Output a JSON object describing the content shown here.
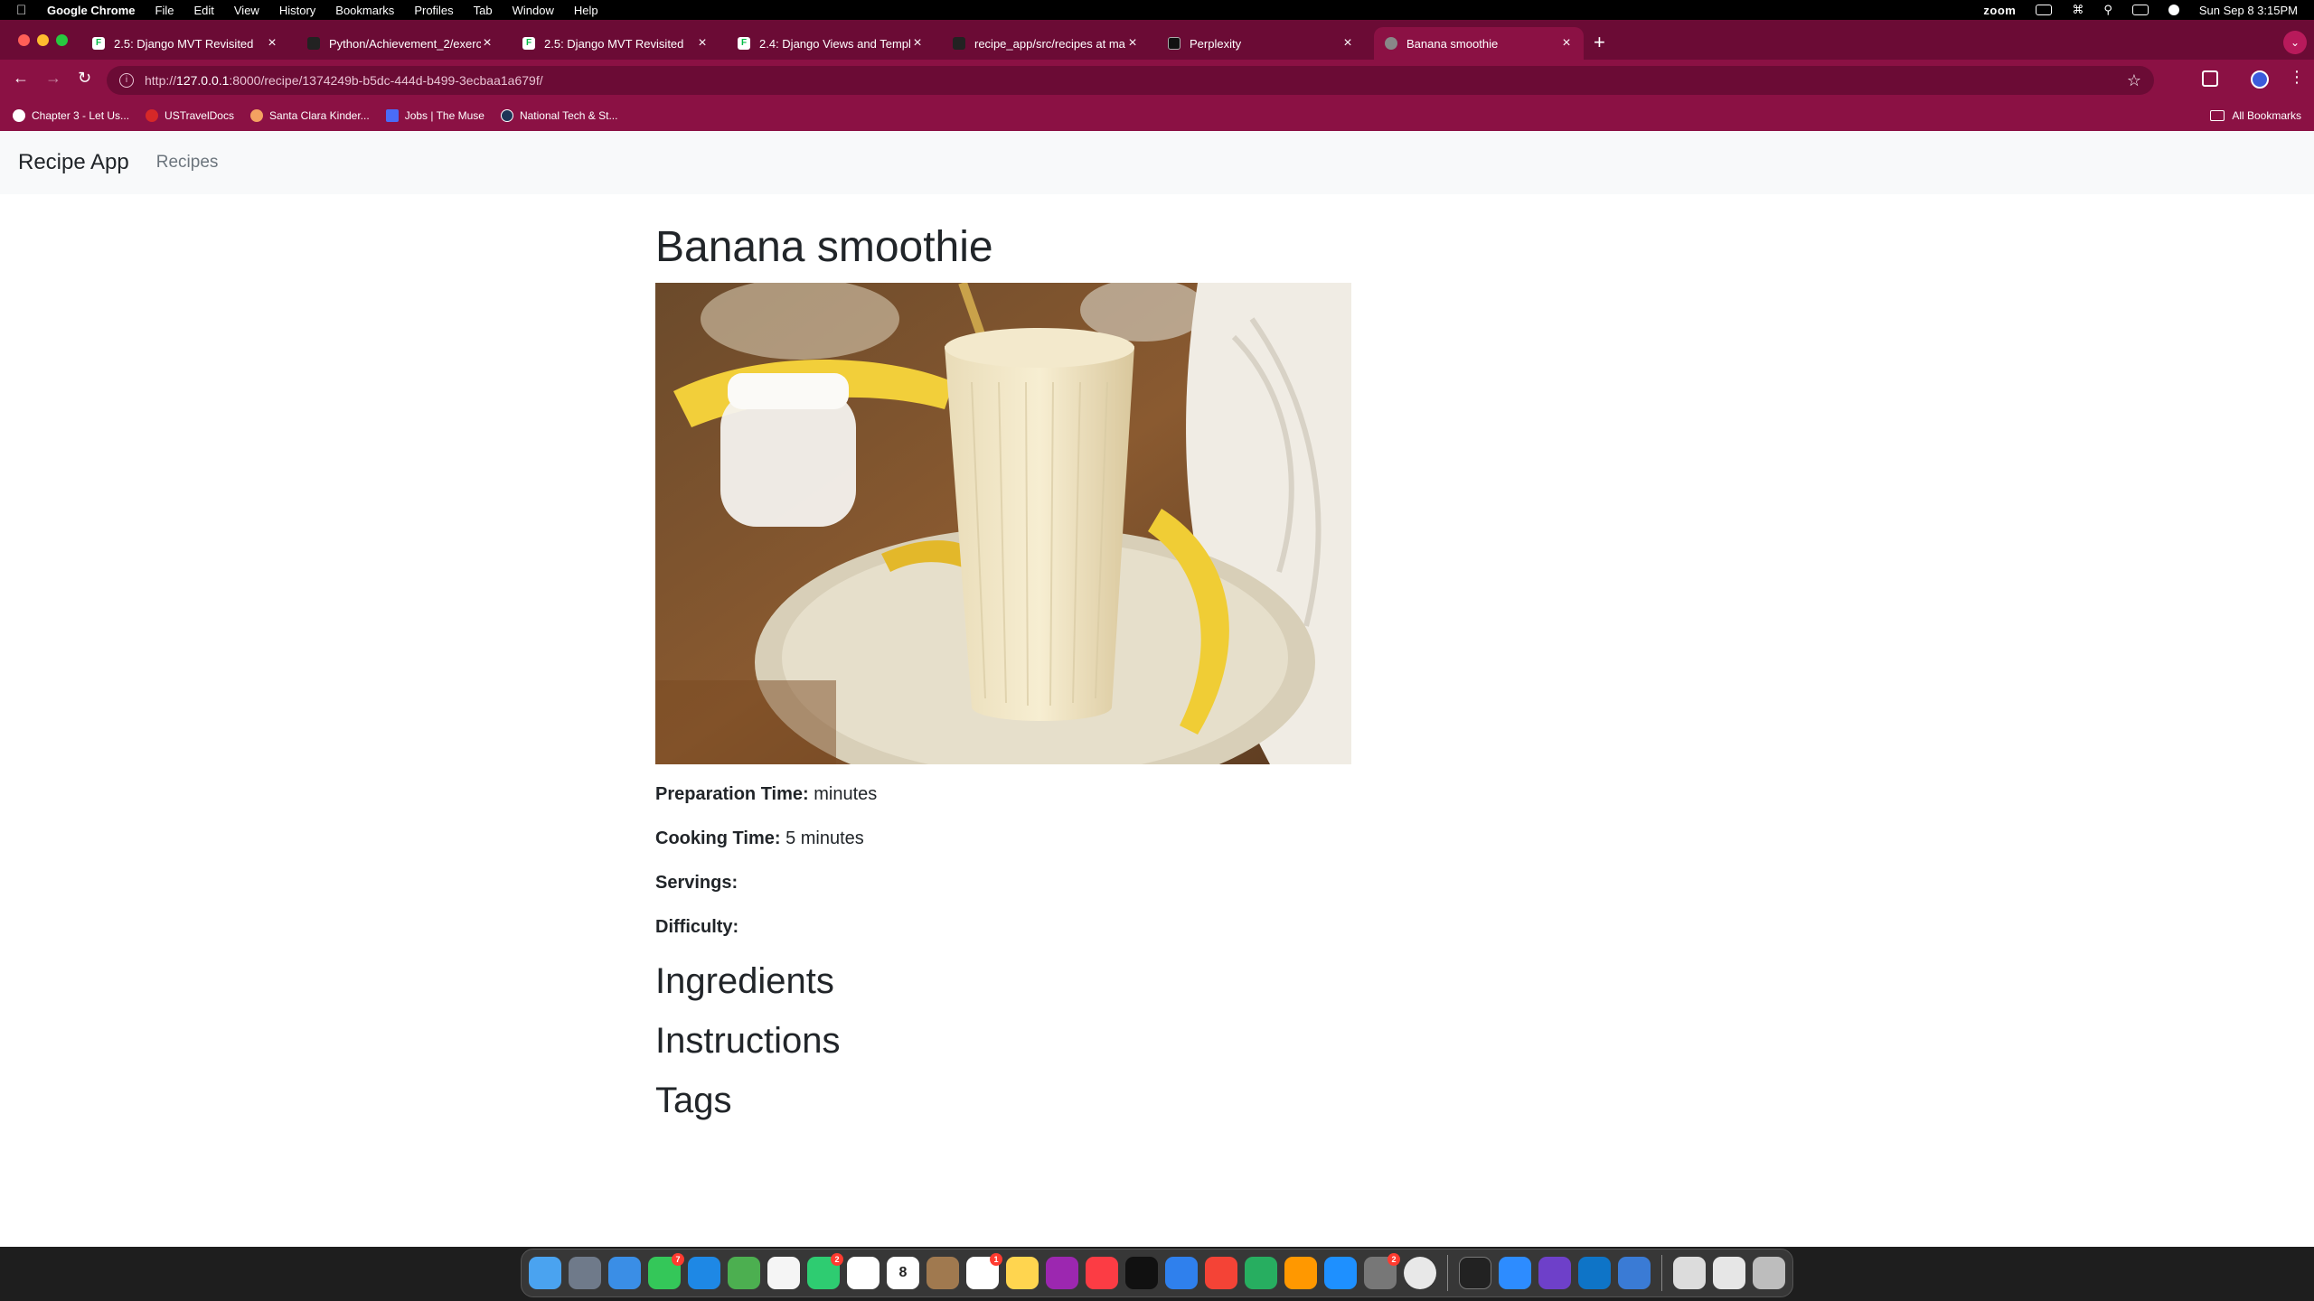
{
  "menubar": {
    "app": "Google Chrome",
    "items": [
      "File",
      "Edit",
      "View",
      "History",
      "Bookmarks",
      "Profiles",
      "Tab",
      "Window",
      "Help"
    ],
    "zoom_label": "zoom",
    "datetime": "Sun Sep 8  3:15PM"
  },
  "tabs": [
    {
      "label": "2.5: Django MVT Revisited"
    },
    {
      "label": "Python/Achievement_2/exerc"
    },
    {
      "label": "2.5: Django MVT Revisited"
    },
    {
      "label": "2.4: Django Views and Templ"
    },
    {
      "label": "recipe_app/src/recipes at ma"
    },
    {
      "label": "Perplexity"
    },
    {
      "label": "Banana smoothie"
    }
  ],
  "address": {
    "prefix": "http://",
    "host": "127.0.0.1",
    "rest": ":8000/recipe/1374249b-b5dc-444d-b499-3ecbaa1a679f/"
  },
  "bookmarks": {
    "items": [
      {
        "label": "Chapter 3 - Let Us...",
        "color": "#ffffff"
      },
      {
        "label": "USTravelDocs",
        "color": "#d62828"
      },
      {
        "label": "Santa Clara Kinder...",
        "color": "#f4a261"
      },
      {
        "label": "Jobs | The Muse",
        "color": "#4a6cf7"
      },
      {
        "label": "National Tech & St...",
        "color": "#1d3557"
      }
    ],
    "all_label": "All Bookmarks"
  },
  "site": {
    "brand": "Recipe App",
    "nav_recipes": "Recipes"
  },
  "recipe": {
    "title": "Banana smoothie",
    "prep_label": "Preparation Time:",
    "prep_value": " minutes",
    "cook_label": "Cooking Time:",
    "cook_value": " 5 minutes",
    "servings_label": "Servings:",
    "servings_value": "",
    "difficulty_label": "Difficulty:",
    "difficulty_value": "",
    "ingredients_heading": "Ingredients",
    "instructions_heading": "Instructions",
    "tags_heading": "Tags"
  },
  "dock": {
    "calendar_day": "8",
    "messages_badge": "7",
    "facetime_badge": "2",
    "reminders_badge": "1",
    "settings_badge": "2"
  }
}
